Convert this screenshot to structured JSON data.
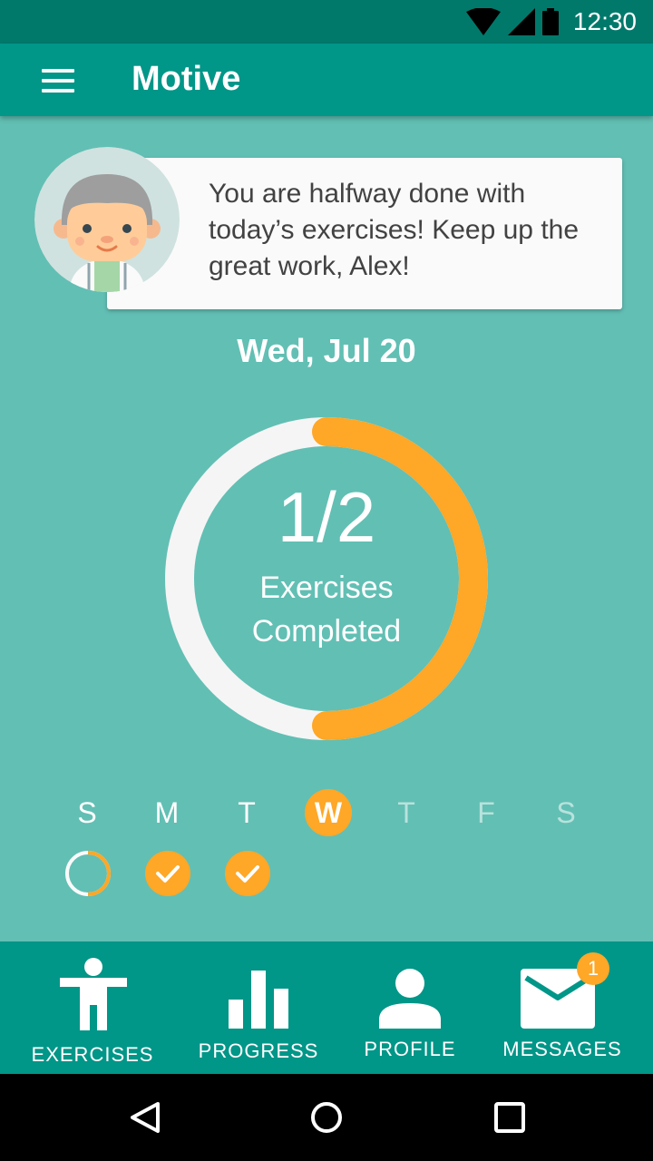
{
  "status_bar": {
    "time": "12:30",
    "icons": [
      "wifi-icon",
      "cellular-signal-icon",
      "battery-icon"
    ]
  },
  "app_bar": {
    "title": "Motive",
    "menu_icon": "hamburger-menu-icon"
  },
  "coach": {
    "avatar_icon": "doctor-avatar",
    "message": "You are halfway done with today’s exercises! Keep up the great work, Alex!"
  },
  "date": "Wed, Jul 20",
  "progress": {
    "count_text": "1/2",
    "label_line1": "Exercises",
    "label_line2": "Completed",
    "fraction": 0.5
  },
  "week": [
    {
      "letter": "S",
      "state": "partial"
    },
    {
      "letter": "M",
      "state": "complete"
    },
    {
      "letter": "T",
      "state": "complete"
    },
    {
      "letter": "W",
      "state": "today"
    },
    {
      "letter": "T",
      "state": "future"
    },
    {
      "letter": "F",
      "state": "future"
    },
    {
      "letter": "S",
      "state": "future"
    }
  ],
  "bottom_nav": [
    {
      "label": "EXERCISES",
      "icon": "person-icon",
      "active": true
    },
    {
      "label": "PROGRESS",
      "icon": "bar-chart-icon"
    },
    {
      "label": "PROFILE",
      "icon": "profile-icon"
    },
    {
      "label": "MESSAGES",
      "icon": "mail-icon",
      "badge": "1"
    }
  ],
  "system_nav": [
    "back-icon",
    "home-icon",
    "recents-icon"
  ],
  "colors": {
    "status_bar": "#00796b",
    "app_bar": "#009688",
    "background": "#62bfb4",
    "accent": "#ffa726",
    "card": "#fafafa"
  }
}
